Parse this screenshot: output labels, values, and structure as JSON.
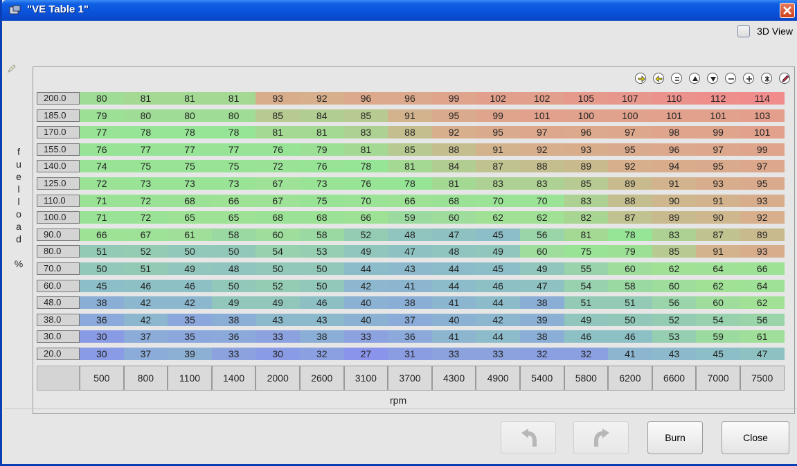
{
  "window": {
    "title": "\"VE Table 1\""
  },
  "toolbar": {
    "view3d_label": "3D View",
    "icons": [
      "arrow-right-icon",
      "arrow-left-icon",
      "equals-icon",
      "increase-icon",
      "decrease-icon",
      "minus-icon",
      "plus-icon",
      "multiply-icon",
      "pencil-icon"
    ]
  },
  "table": {
    "y_axis_label": [
      "f",
      "u",
      "e",
      "l",
      "l",
      "o",
      "a",
      "d",
      "",
      "%"
    ],
    "x_axis_label": "rpm",
    "y_values": [
      "200.0",
      "185.0",
      "170.0",
      "155.0",
      "140.0",
      "125.0",
      "110.0",
      "100.0",
      "90.0",
      "80.0",
      "70.0",
      "60.0",
      "48.0",
      "38.0",
      "30.0",
      "20.0"
    ],
    "x_values": [
      "500",
      "800",
      "1100",
      "1400",
      "2000",
      "2600",
      "3100",
      "3700",
      "4300",
      "4900",
      "5400",
      "5800",
      "6200",
      "6600",
      "7000",
      "7500"
    ],
    "rows": [
      [
        80,
        81,
        81,
        81,
        93,
        92,
        96,
        96,
        99,
        102,
        102,
        105,
        107,
        110,
        112,
        114
      ],
      [
        79,
        80,
        80,
        80,
        85,
        84,
        85,
        91,
        95,
        99,
        101,
        100,
        100,
        101,
        101,
        103
      ],
      [
        77,
        78,
        78,
        78,
        81,
        81,
        83,
        88,
        92,
        95,
        97,
        96,
        97,
        98,
        99,
        101
      ],
      [
        76,
        77,
        77,
        77,
        76,
        79,
        81,
        85,
        88,
        91,
        92,
        93,
        95,
        96,
        97,
        99
      ],
      [
        74,
        75,
        75,
        75,
        72,
        76,
        78,
        81,
        84,
        87,
        88,
        89,
        92,
        94,
        95,
        97
      ],
      [
        72,
        73,
        73,
        73,
        67,
        73,
        76,
        78,
        81,
        83,
        83,
        85,
        89,
        91,
        93,
        95
      ],
      [
        71,
        72,
        68,
        66,
        67,
        75,
        70,
        66,
        68,
        70,
        70,
        83,
        88,
        90,
        91,
        93
      ],
      [
        71,
        72,
        65,
        65,
        68,
        68,
        66,
        59,
        60,
        62,
        62,
        82,
        87,
        89,
        90,
        92
      ],
      [
        66,
        67,
        61,
        58,
        60,
        58,
        52,
        48,
        47,
        45,
        56,
        81,
        78,
        83,
        87,
        89
      ],
      [
        51,
        52,
        50,
        50,
        54,
        53,
        49,
        47,
        48,
        49,
        60,
        75,
        79,
        85,
        91,
        93
      ],
      [
        50,
        51,
        49,
        48,
        50,
        50,
        44,
        43,
        44,
        45,
        49,
        55,
        60,
        62,
        64,
        66
      ],
      [
        45,
        46,
        46,
        50,
        52,
        50,
        42,
        41,
        44,
        46,
        47,
        54,
        58,
        60,
        62,
        64
      ],
      [
        38,
        42,
        42,
        49,
        49,
        46,
        40,
        38,
        41,
        44,
        38,
        51,
        51,
        56,
        60,
        62
      ],
      [
        36,
        42,
        35,
        38,
        43,
        43,
        40,
        37,
        40,
        42,
        39,
        49,
        50,
        52,
        54,
        56
      ],
      [
        30,
        37,
        35,
        36,
        33,
        38,
        33,
        36,
        41,
        44,
        38,
        46,
        46,
        53,
        59,
        61
      ],
      [
        30,
        37,
        39,
        33,
        30,
        32,
        27,
        31,
        33,
        33,
        32,
        32,
        41,
        43,
        45,
        47
      ]
    ]
  },
  "buttons": {
    "burn": "Burn",
    "close": "Close"
  }
}
